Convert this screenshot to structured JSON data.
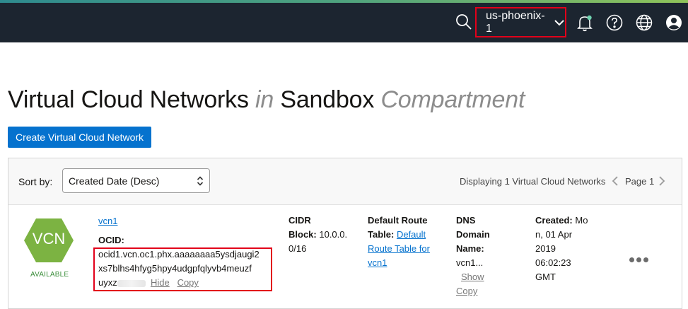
{
  "topbar": {
    "region": "us-phoenix-1",
    "icons": [
      "search-icon",
      "bell-icon",
      "help-icon",
      "globe-icon",
      "user-icon"
    ]
  },
  "title": {
    "part1": "Virtual Cloud Networks",
    "in": "in",
    "compartment_name": "Sandbox",
    "compartment_word": "Compartment"
  },
  "create_button": "Create Virtual Cloud Network",
  "toolbar": {
    "sort_label": "Sort by:",
    "sort_value": "Created Date (Desc)",
    "displaying": "Displaying 1 Virtual Cloud Networks",
    "page": "Page 1"
  },
  "vcn": {
    "badge": "VCN",
    "state": "AVAILABLE",
    "name": "vcn1",
    "ocid_label": "OCID:",
    "ocid_line1": "ocid1.vcn.oc1.phx.aaaaaaaa5ysdjaugi2",
    "ocid_line2": "xs7blhs4hfyg5hpy4udgpfqlyvb4meuzf",
    "ocid_line3": "uyxz",
    "hide": "Hide",
    "copy": "Copy",
    "cidr_label1": "CIDR",
    "cidr_label2": "Block:",
    "cidr_value1": "10.0.0.",
    "cidr_value2": "0/16",
    "route_label1": "Default Route",
    "route_label2": "Table:",
    "route_link1": "Default",
    "route_link2": "Route Table for",
    "route_link3": "vcn1",
    "dns_label1": "DNS",
    "dns_label2": "Domain",
    "dns_label3": "Name:",
    "dns_value": "vcn1...",
    "dns_show": "Show",
    "dns_copy": "Copy",
    "created_label": "Created:",
    "created_1": "Mo",
    "created_2": "n, 01 Apr",
    "created_3": "2019",
    "created_4": "06:02:23",
    "created_5": "GMT"
  },
  "colors": {
    "topbar": "#1c2530",
    "accent": "#0572ce",
    "highlight": "#e2001a",
    "vcn_green": "#7cb342",
    "available_green": "#3a8d3a"
  }
}
